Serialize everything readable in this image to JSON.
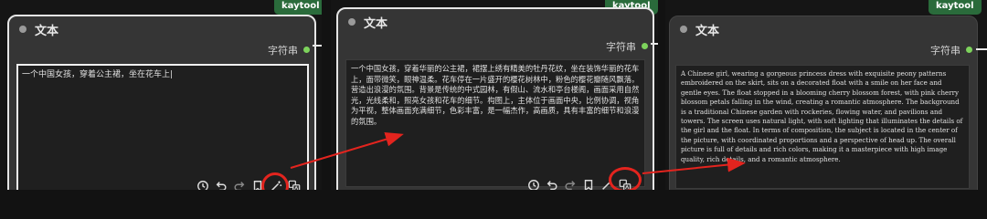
{
  "node": {
    "title": "文本",
    "output_label": "字符串",
    "badge": "kaytool"
  },
  "panels": [
    {
      "text": "一个中国女孩，穿着公主裙，坐在花车上|"
    },
    {
      "text": "一个中国女孩，穿着华丽的公主裙，裙摆上绣有精美的牡丹花纹，坐在装饰华丽的花车上，面带微笑，眼神温柔。花车停在一片盛开的樱花树林中，粉色的樱花瓣随风飘落。营造出浪漫的氛围。背景是传统的中式园林，有假山、流水和亭台楼阁，画面采用自然光，光线柔和，照亮女孩和花车的细节。构图上，主体位于画面中央，比例协调，视角为平视，整体画面充满细节，色彩丰富，是一幅杰作，高画质，具有丰富的细节和浪漫的氛围。"
    },
    {
      "text": "A Chinese girl, wearing a gorgeous princess dress with exquisite peony patterns embroidered on the skirt, sits on a decorated float with a smile on her face and gentle eyes. The float stopped in a blooming cherry blossom forest, with pink cherry blossom petals falling in the wind, creating a romantic atmosphere. The background is a traditional Chinese garden with rockeries, flowing water, and pavilions and towers. The screen uses natural light, with soft lighting that illuminates the details of the girl and the float. In terms of composition, the subject is located in the center of the picture, with coordinated proportions and a perspective of head up. The overall picture is full of details and rich colors, making it a masterpiece with high image quality, rich details, and a romantic atmosphere."
    }
  ],
  "toolbar_icons": [
    "history-icon",
    "undo-icon",
    "redo-icon",
    "bookmark-icon",
    "magic-wand-icon",
    "translate-icon"
  ],
  "colors": {
    "annotation": "#e3241e",
    "output_dot": "#7dd35c",
    "badge": "#2a6b3b"
  }
}
